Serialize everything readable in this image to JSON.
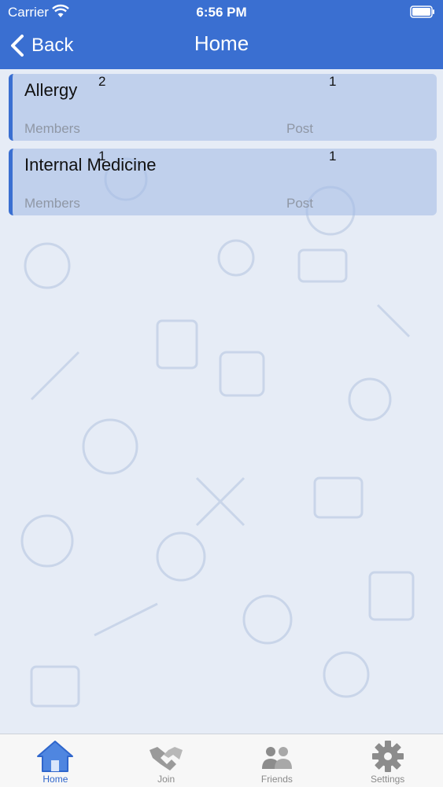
{
  "status_bar": {
    "carrier": "Carrier",
    "time": "6:56 PM"
  },
  "nav": {
    "back_label": "Back",
    "title": "Home"
  },
  "groups": [
    {
      "name": "Allergy",
      "members_label": "Members",
      "members": "2",
      "post_label": "Post",
      "posts": "1"
    },
    {
      "name": "Internal Medicine",
      "members_label": "Members",
      "members": "1",
      "post_label": "Post",
      "posts": "1"
    }
  ],
  "tabs": [
    {
      "label": "Home",
      "icon": "home-icon",
      "active": true
    },
    {
      "label": "Join",
      "icon": "handshake-icon",
      "active": false
    },
    {
      "label": "Friends",
      "icon": "friends-icon",
      "active": false
    },
    {
      "label": "Settings",
      "icon": "gear-icon",
      "active": false
    }
  ],
  "colors": {
    "primary": "#3a6fd1",
    "card": "#a4bce6",
    "tab_active": "#2f66cc",
    "tab_inactive": "#8a8a8a"
  }
}
